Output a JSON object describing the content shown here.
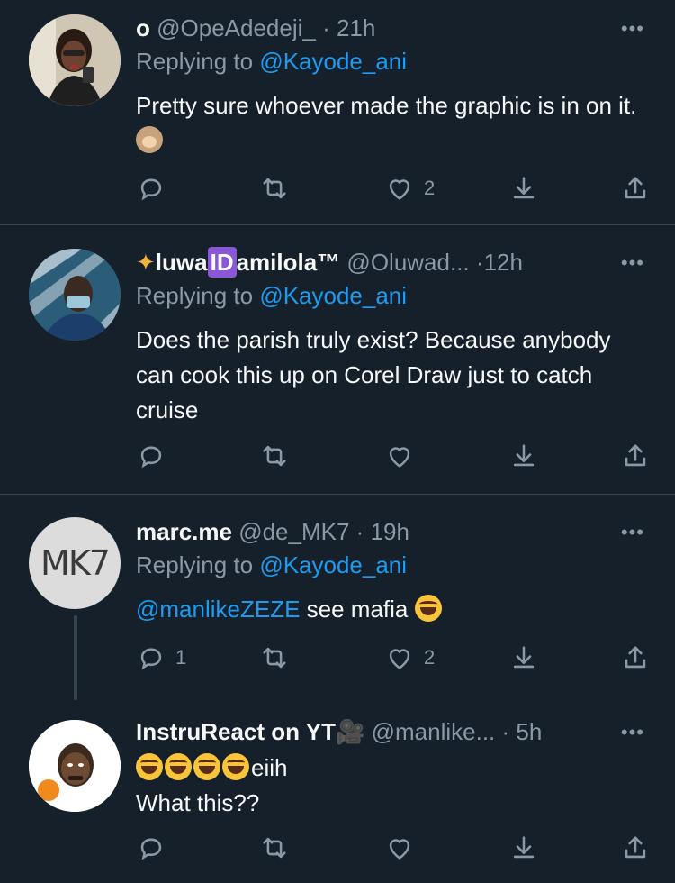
{
  "colors": {
    "background": "#15202b",
    "divider": "#38444d",
    "secondary_text": "#8b98a5",
    "link": "#1d9bf0"
  },
  "icons": {
    "reply": "reply-icon",
    "retweet": "retweet-icon",
    "like": "heart-icon",
    "bookmark": "download-icon",
    "share": "share-icon",
    "more": "more-dots-icon"
  },
  "tweets": [
    {
      "name": "o",
      "handle": "@OpeAdedeji_",
      "dot": "·",
      "time": "21h",
      "replying_prefix": "Replying to ",
      "replying_to": "@Kayode_ani",
      "text": "Pretty sure whoever made the graphic is in on it.",
      "emoji": "see-no-evil-monkey",
      "reply_count": "",
      "retweet_count": "",
      "like_count": "2"
    },
    {
      "name_prefix_emoji": "dizzy",
      "name_part1": "luwa",
      "name_badge": "ID",
      "name_part2": "amilola™",
      "handle": "@Oluwad...",
      "dot": "·",
      "time": "12h",
      "replying_prefix": "Replying to ",
      "replying_to": "@Kayode_ani",
      "text": "Does the parish truly exist? Because anybody can cook this up on Corel Draw just to catch cruise",
      "reply_count": "",
      "retweet_count": "",
      "like_count": ""
    },
    {
      "name": "marc.me",
      "avatar_text": "MK7",
      "handle": "@de_MK7",
      "dot": "·",
      "time": "19h",
      "replying_prefix": "Replying to ",
      "replying_to": "@Kayode_ani",
      "mention": "@manlikeZEZE",
      "text": " see mafia",
      "emoji": "face-with-tears-of-joy",
      "reply_count": "1",
      "retweet_count": "",
      "like_count": "2"
    },
    {
      "name": "InstruReact on YT",
      "name_suffix_emoji": "film-projector",
      "handle": "@manlike...",
      "dot": "·",
      "time": "5h",
      "line1_suffix": "eiih",
      "line1_emoji_count": 4,
      "line2": "What this??",
      "reply_count": "",
      "retweet_count": "",
      "like_count": ""
    }
  ]
}
